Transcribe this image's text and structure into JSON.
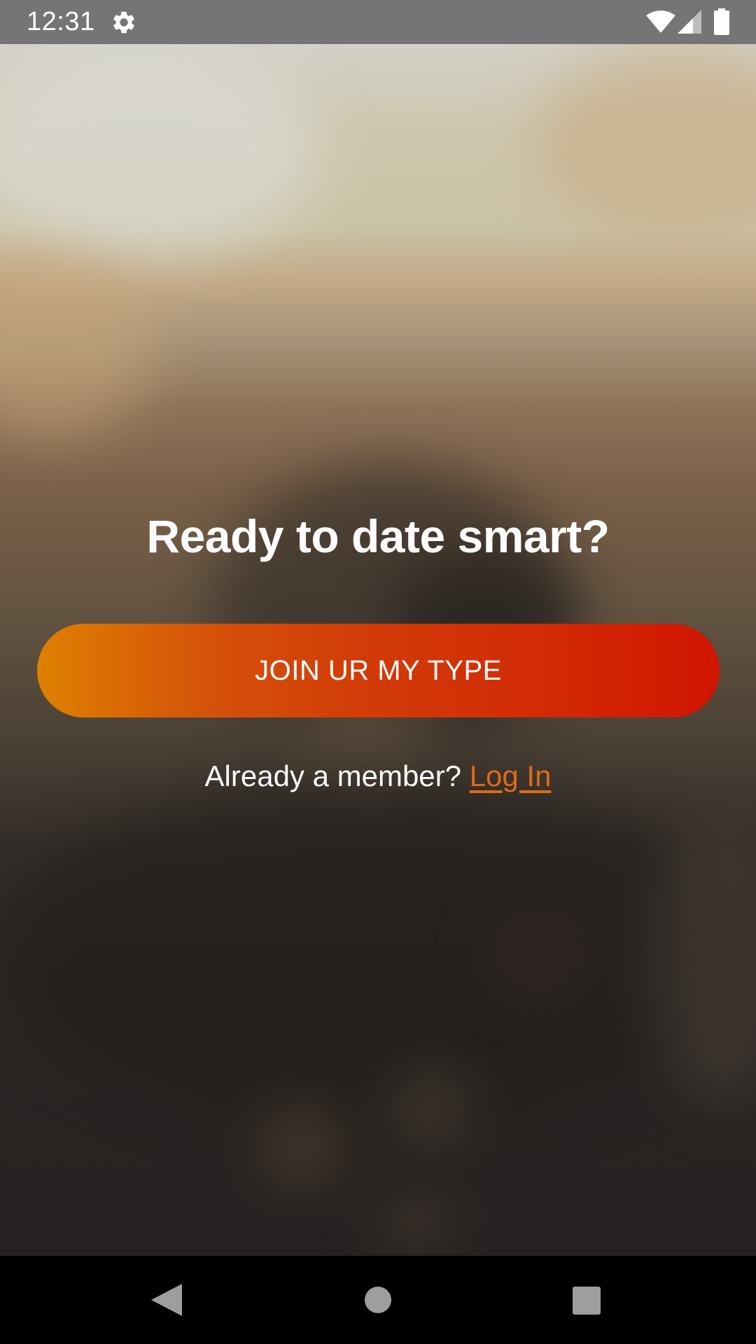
{
  "status_bar": {
    "time": "12:31",
    "icons": [
      "gear-icon",
      "wifi-icon",
      "cell-signal-icon",
      "battery-icon"
    ]
  },
  "main": {
    "headline": "Ready to date smart?",
    "join_button_label": "JOIN UR MY TYPE",
    "login_prompt": "Already a member?",
    "login_link": "Log In"
  },
  "nav_bar": {
    "icons": [
      "back-icon",
      "home-icon",
      "recents-icon"
    ]
  },
  "colors": {
    "accent": "#e06a18",
    "button_gradient_start": "#df8000",
    "button_gradient_end": "#d01500",
    "status_bar": "#757575",
    "nav_bar": "#000000"
  }
}
